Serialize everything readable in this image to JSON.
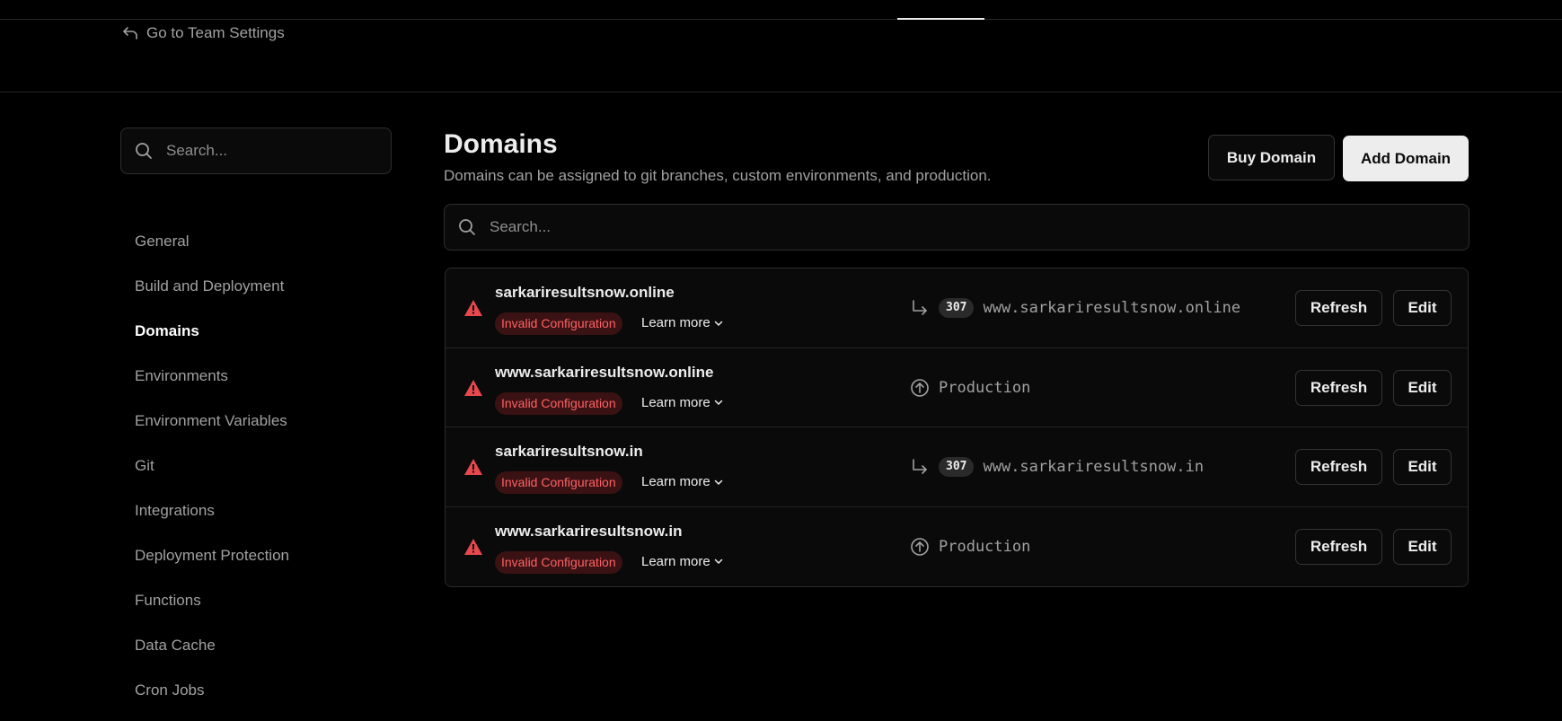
{
  "header": {
    "back_link": "Go to Team Settings"
  },
  "sidebar": {
    "search_placeholder": "Search...",
    "items": [
      {
        "label": "General",
        "active": false
      },
      {
        "label": "Build and Deployment",
        "active": false
      },
      {
        "label": "Domains",
        "active": true
      },
      {
        "label": "Environments",
        "active": false
      },
      {
        "label": "Environment Variables",
        "active": false
      },
      {
        "label": "Git",
        "active": false
      },
      {
        "label": "Integrations",
        "active": false
      },
      {
        "label": "Deployment Protection",
        "active": false
      },
      {
        "label": "Functions",
        "active": false
      },
      {
        "label": "Data Cache",
        "active": false
      },
      {
        "label": "Cron Jobs",
        "active": false
      }
    ]
  },
  "main": {
    "title": "Domains",
    "subtitle": "Domains can be assigned to git branches, custom environments, and production.",
    "buy_button": "Buy Domain",
    "add_button": "Add Domain",
    "search_placeholder": "Search..."
  },
  "domains": [
    {
      "name": "sarkariresultsnow.online",
      "status": "Invalid Configuration",
      "learn_more": "Learn more",
      "target_type": "redirect",
      "code": "307",
      "target": "www.sarkariresultsnow.online",
      "refresh": "Refresh",
      "edit": "Edit"
    },
    {
      "name": "www.sarkariresultsnow.online",
      "status": "Invalid Configuration",
      "learn_more": "Learn more",
      "target_type": "production",
      "code": "",
      "target": "Production",
      "refresh": "Refresh",
      "edit": "Edit"
    },
    {
      "name": "sarkariresultsnow.in",
      "status": "Invalid Configuration",
      "learn_more": "Learn more",
      "target_type": "redirect",
      "code": "307",
      "target": "www.sarkariresultsnow.in",
      "refresh": "Refresh",
      "edit": "Edit"
    },
    {
      "name": "www.sarkariresultsnow.in",
      "status": "Invalid Configuration",
      "learn_more": "Learn more",
      "target_type": "production",
      "code": "",
      "target": "Production",
      "refresh": "Refresh",
      "edit": "Edit"
    }
  ],
  "colors": {
    "background": "#000000",
    "error_text": "#ff6166",
    "error_badge_bg": "#3b1213",
    "warning_icon": "#e5484d",
    "primary_button_bg": "#ededed"
  }
}
